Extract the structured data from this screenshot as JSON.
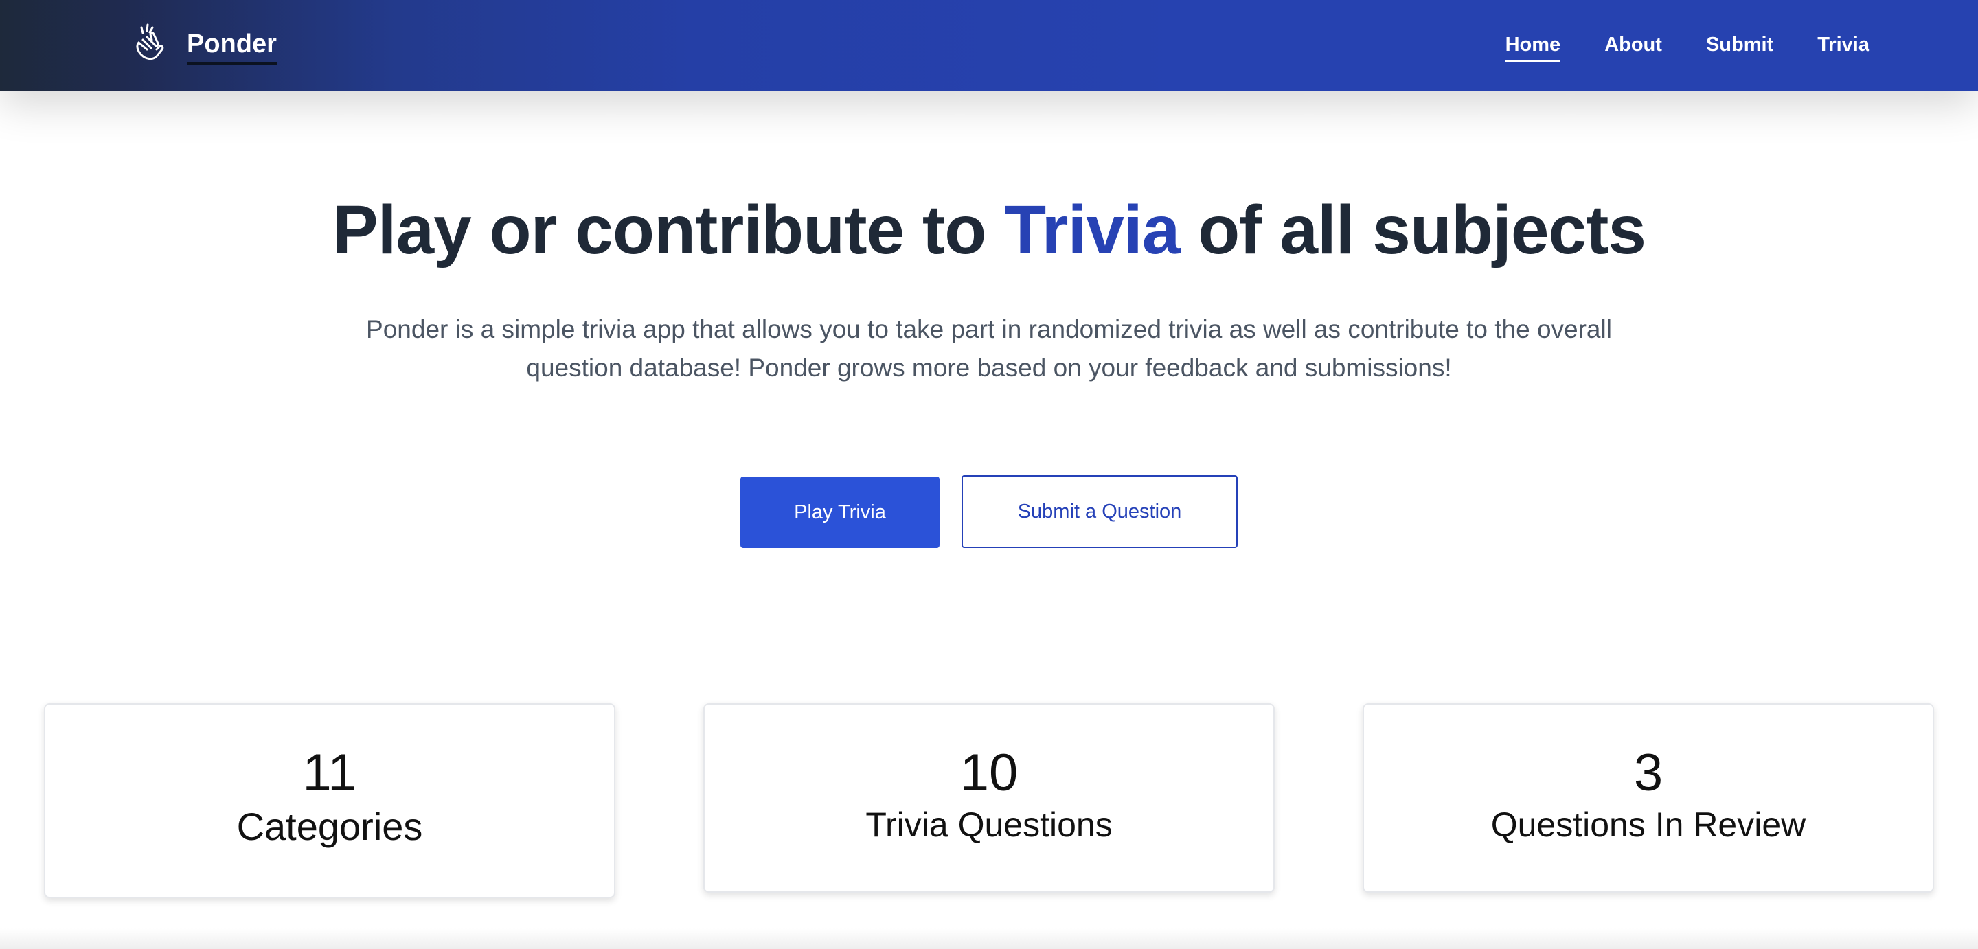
{
  "brand": {
    "name": "Ponder",
    "icon": "snap-fingers-icon"
  },
  "nav": {
    "items": [
      {
        "label": "Home",
        "active": true
      },
      {
        "label": "About",
        "active": false
      },
      {
        "label": "Submit",
        "active": false
      },
      {
        "label": "Trivia",
        "active": false
      }
    ]
  },
  "hero": {
    "title_before": "Play or contribute to ",
    "title_accent": "Trivia",
    "title_after": " of all subjects",
    "description": "Ponder is a simple trivia app that allows you to take part in randomized trivia as well as contribute to the overall question database! Ponder grows more based on your feedback and submissions!",
    "primary_button": "Play Trivia",
    "secondary_button": "Submit a Question"
  },
  "stats": [
    {
      "value": "11",
      "label": "Categories"
    },
    {
      "value": "10",
      "label": "Trivia Questions"
    },
    {
      "value": "3",
      "label": "Questions In Review"
    }
  ],
  "colors": {
    "nav_dark": "#1e293b",
    "nav_blue": "#2642b0",
    "accent": "#2742b4",
    "primary_button": "#2b52d8",
    "heading": "#1f2937",
    "body_text": "#4b5563"
  }
}
